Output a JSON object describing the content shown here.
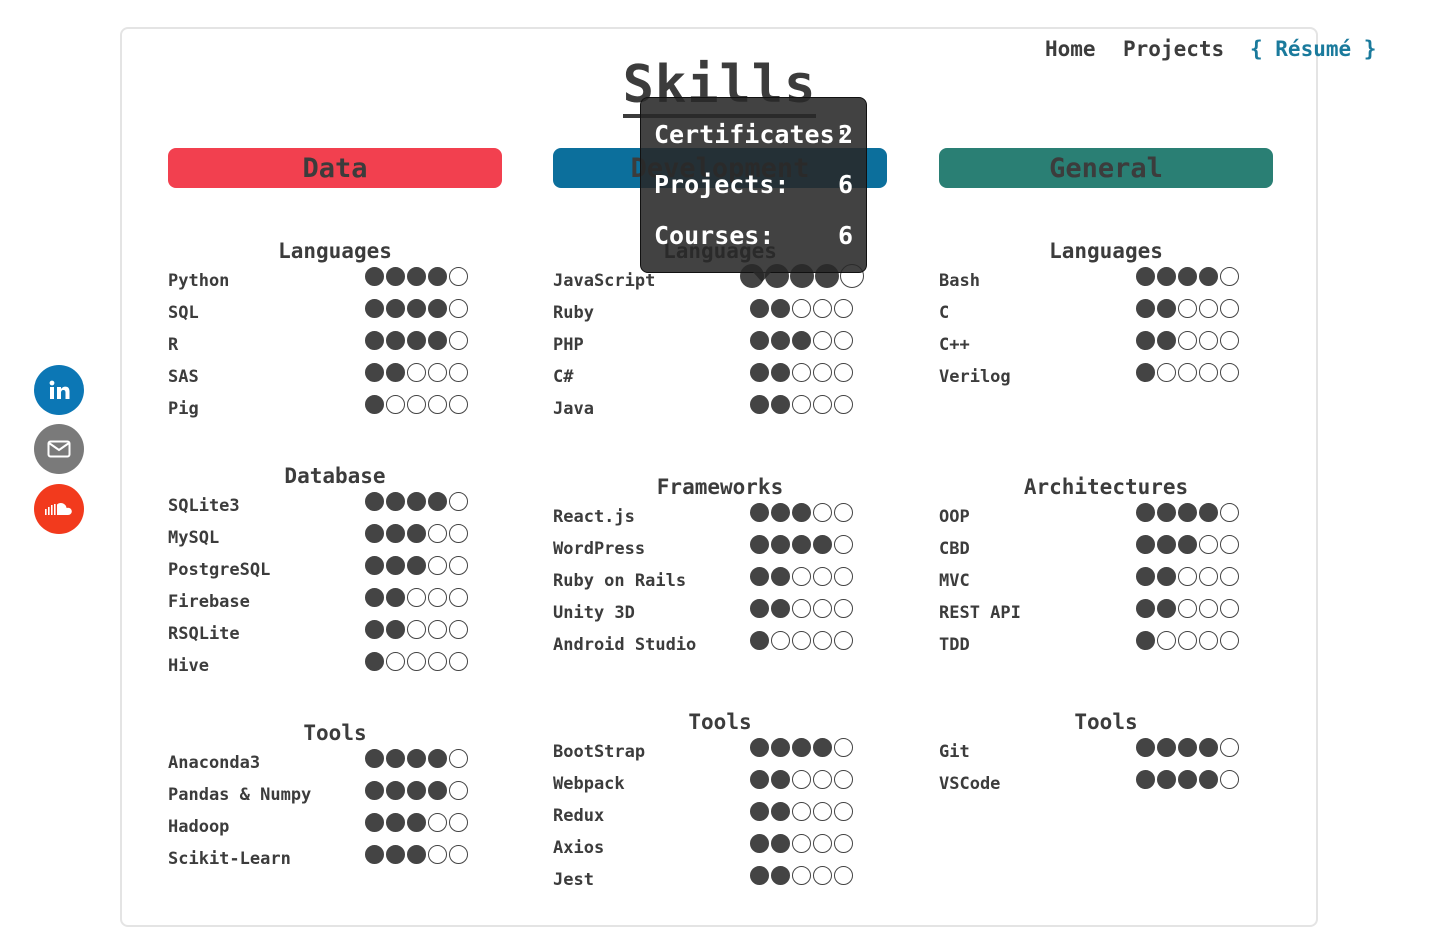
{
  "nav": {
    "home": "Home",
    "projects": "Projects",
    "resume": "{ Résumé }"
  },
  "page_title": "Skills",
  "tooltip": {
    "certificates_label": "Certificates:",
    "certificates_value": "2",
    "projects_label": "Projects:",
    "projects_value": "6",
    "courses_label": "Courses:",
    "courses_value": "6"
  },
  "colors": {
    "data": "#f2404f",
    "development": "#0c6f9c",
    "general": "#2a7f74",
    "linkedin": "#0c77b5",
    "email": "#7a7a7a",
    "soundcloud": "#f23a1d",
    "resume": "#1a7a9c"
  },
  "social": [
    {
      "icon": "linkedin-icon"
    },
    {
      "icon": "email-icon"
    },
    {
      "icon": "soundcloud-icon"
    }
  ],
  "columns": [
    {
      "header": "Data",
      "groups": [
        {
          "title": "Languages",
          "skills": [
            {
              "name": "Python",
              "level": 4
            },
            {
              "name": "SQL",
              "level": 4
            },
            {
              "name": "R",
              "level": 4
            },
            {
              "name": "SAS",
              "level": 2
            },
            {
              "name": "Pig",
              "level": 1
            }
          ]
        },
        {
          "title": "Database",
          "skills": [
            {
              "name": "SQLite3",
              "level": 4
            },
            {
              "name": "MySQL",
              "level": 3
            },
            {
              "name": "PostgreSQL",
              "level": 3
            },
            {
              "name": "Firebase",
              "level": 2
            },
            {
              "name": "RSQLite",
              "level": 2
            },
            {
              "name": "Hive",
              "level": 1
            }
          ]
        },
        {
          "title": "Tools",
          "skills": [
            {
              "name": "Anaconda3",
              "level": 4
            },
            {
              "name": "Pandas & Numpy",
              "level": 4
            },
            {
              "name": "Hadoop",
              "level": 3
            },
            {
              "name": "Scikit-Learn",
              "level": 3
            }
          ]
        }
      ]
    },
    {
      "header": "Development",
      "groups": [
        {
          "title": "Languages",
          "skills": [
            {
              "name": "JavaScript",
              "level": 4
            },
            {
              "name": "Ruby",
              "level": 2
            },
            {
              "name": "PHP",
              "level": 3
            },
            {
              "name": "C#",
              "level": 2
            },
            {
              "name": "Java",
              "level": 2
            }
          ]
        },
        {
          "title": "Frameworks",
          "skills": [
            {
              "name": "React.js",
              "level": 3
            },
            {
              "name": "WordPress",
              "level": 4
            },
            {
              "name": "Ruby on Rails",
              "level": 2
            },
            {
              "name": "Unity 3D",
              "level": 2
            },
            {
              "name": "Android Studio",
              "level": 1
            }
          ]
        },
        {
          "title": "Tools",
          "skills": [
            {
              "name": "BootStrap",
              "level": 4
            },
            {
              "name": "Webpack",
              "level": 2
            },
            {
              "name": "Redux",
              "level": 2
            },
            {
              "name": "Axios",
              "level": 2
            },
            {
              "name": "Jest",
              "level": 2
            }
          ]
        }
      ]
    },
    {
      "header": "General",
      "groups": [
        {
          "title": "Languages",
          "skills": [
            {
              "name": "Bash",
              "level": 4
            },
            {
              "name": "C",
              "level": 2
            },
            {
              "name": "C++",
              "level": 2
            },
            {
              "name": "Verilog",
              "level": 1
            }
          ]
        },
        {
          "title": "Architectures",
          "skills": [
            {
              "name": "OOP",
              "level": 4
            },
            {
              "name": "CBD",
              "level": 3
            },
            {
              "name": "MVC",
              "level": 2
            },
            {
              "name": "REST API",
              "level": 2
            },
            {
              "name": "TDD",
              "level": 1
            }
          ]
        },
        {
          "title": "Tools",
          "skills": [
            {
              "name": "Git",
              "level": 4
            },
            {
              "name": "VSCode",
              "level": 4
            }
          ]
        }
      ]
    }
  ]
}
